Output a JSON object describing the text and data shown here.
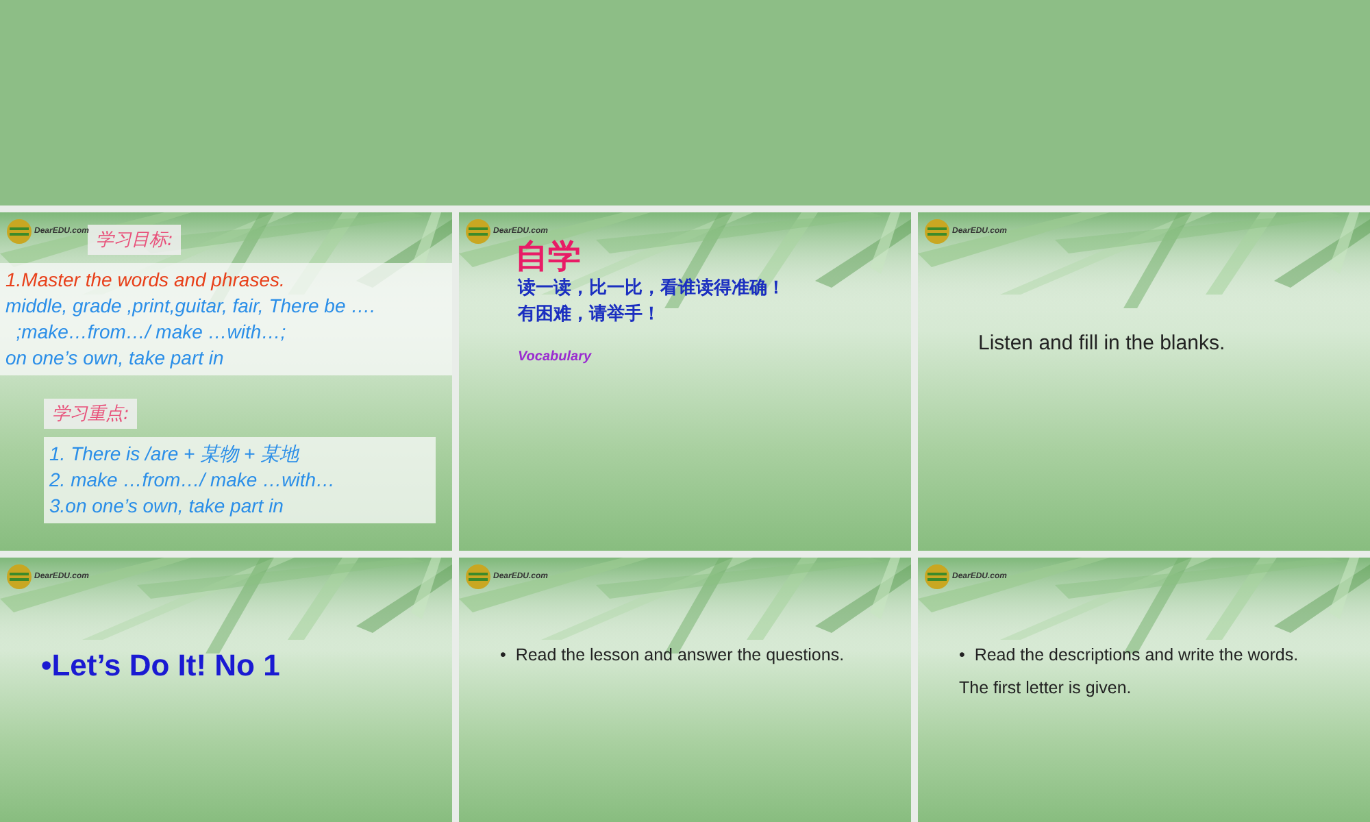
{
  "slides": [
    {
      "kind": "objectives",
      "logo_text": "DearEDU.com",
      "sections": [
        {
          "heading": "学习目标:",
          "wide": true,
          "lines": [
            {
              "text": "1.Master the words and phrases.",
              "color": "#e8401a"
            },
            {
              "text": "middle, grade ,print,guitar, fair, There be ….",
              "color": "#2a8ee8"
            },
            {
              "text": "  ;make…from…/ make …with…;",
              "color": "#2a8ee8"
            },
            {
              "text": "on one’s own, take part in",
              "color": "#2a8ee8"
            }
          ]
        },
        {
          "heading": "学习重点:",
          "wide": false,
          "lines": [
            {
              "text": "1. There is /are + 某物 + 某地",
              "color": "#2a8ee8"
            },
            {
              "text": "2. make …from…/ make …with…",
              "color": "#2a8ee8"
            },
            {
              "text": "3.on one’s own, take part in",
              "color": "#2a8ee8"
            }
          ]
        }
      ]
    },
    {
      "kind": "self_study",
      "logo_text": "DearEDU.com",
      "title": "自学",
      "lines": [
        "读一读，比一比，看谁读得准确！",
        "有困难，请举手！"
      ],
      "note": "Vocabulary"
    },
    {
      "kind": "text",
      "logo_text": "DearEDU.com",
      "text": "Listen and fill in the blanks."
    },
    {
      "kind": "big_bullet",
      "logo_text": "DearEDU.com",
      "bullet": "•",
      "text": "Let’s Do It! No 1"
    },
    {
      "kind": "bullets",
      "logo_text": "DearEDU.com",
      "bullet": "•",
      "text": "Read the lesson and answer the questions."
    },
    {
      "kind": "bullets",
      "logo_text": "DearEDU.com",
      "bullet": "•",
      "text": "Read the descriptions and write the words.",
      "after": "The first letter is given."
    }
  ]
}
